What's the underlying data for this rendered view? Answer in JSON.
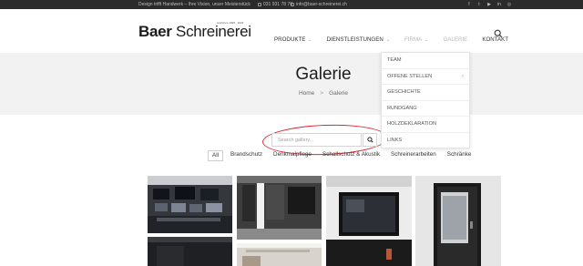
{
  "topbar": {
    "tagline": "Design trifft Handwerk – Ihre Vision, unser Meisterstück",
    "phone": "031 931 78 78",
    "email": "info@baer-schreinerei.ch",
    "social_icons": [
      "facebook-icon",
      "twitter-icon",
      "youtube-icon",
      "linkedin-icon",
      "instagram-icon"
    ]
  },
  "header": {
    "logo_bold": "Baer",
    "logo_rest": " Schreinerei",
    "logo_sub": "seit/since 1925 · 2023",
    "nav": [
      {
        "label": "PRODUKTE",
        "has_dropdown": true
      },
      {
        "label": "DIENSTLEISTUNGEN",
        "has_dropdown": true
      },
      {
        "label": "FIRMA",
        "has_dropdown": true
      },
      {
        "label": "GALERIE",
        "has_dropdown": false
      },
      {
        "label": "KONTAKT",
        "has_dropdown": false
      }
    ]
  },
  "dropdown": {
    "items": [
      {
        "label": "TEAM",
        "submenu": false
      },
      {
        "label": "OFFENE STELLEN",
        "submenu": true
      },
      {
        "label": "GESCHICHTE",
        "submenu": false
      },
      {
        "label": "RUNDGANG",
        "submenu": false
      },
      {
        "label": "HOLZDEKLARATION",
        "submenu": false
      },
      {
        "label": "LINKS",
        "submenu": false
      }
    ]
  },
  "page": {
    "title": "Galerie",
    "breadcrumb": [
      "Home",
      "Galerie"
    ],
    "breadcrumb_sep": ">"
  },
  "gallery": {
    "search_placeholder": "Search gallery...",
    "filters": [
      "All",
      "Brandschutz",
      "Denkmalpflege",
      "Schallschutz & Akustik",
      "Schreinerarbeiten",
      "Schränke"
    ],
    "active_filter": "All"
  },
  "colors": {
    "topbar_bg": "#2b2b2b",
    "title_band_bg": "#f2f2f2",
    "highlight_circle": "#e2262d"
  }
}
